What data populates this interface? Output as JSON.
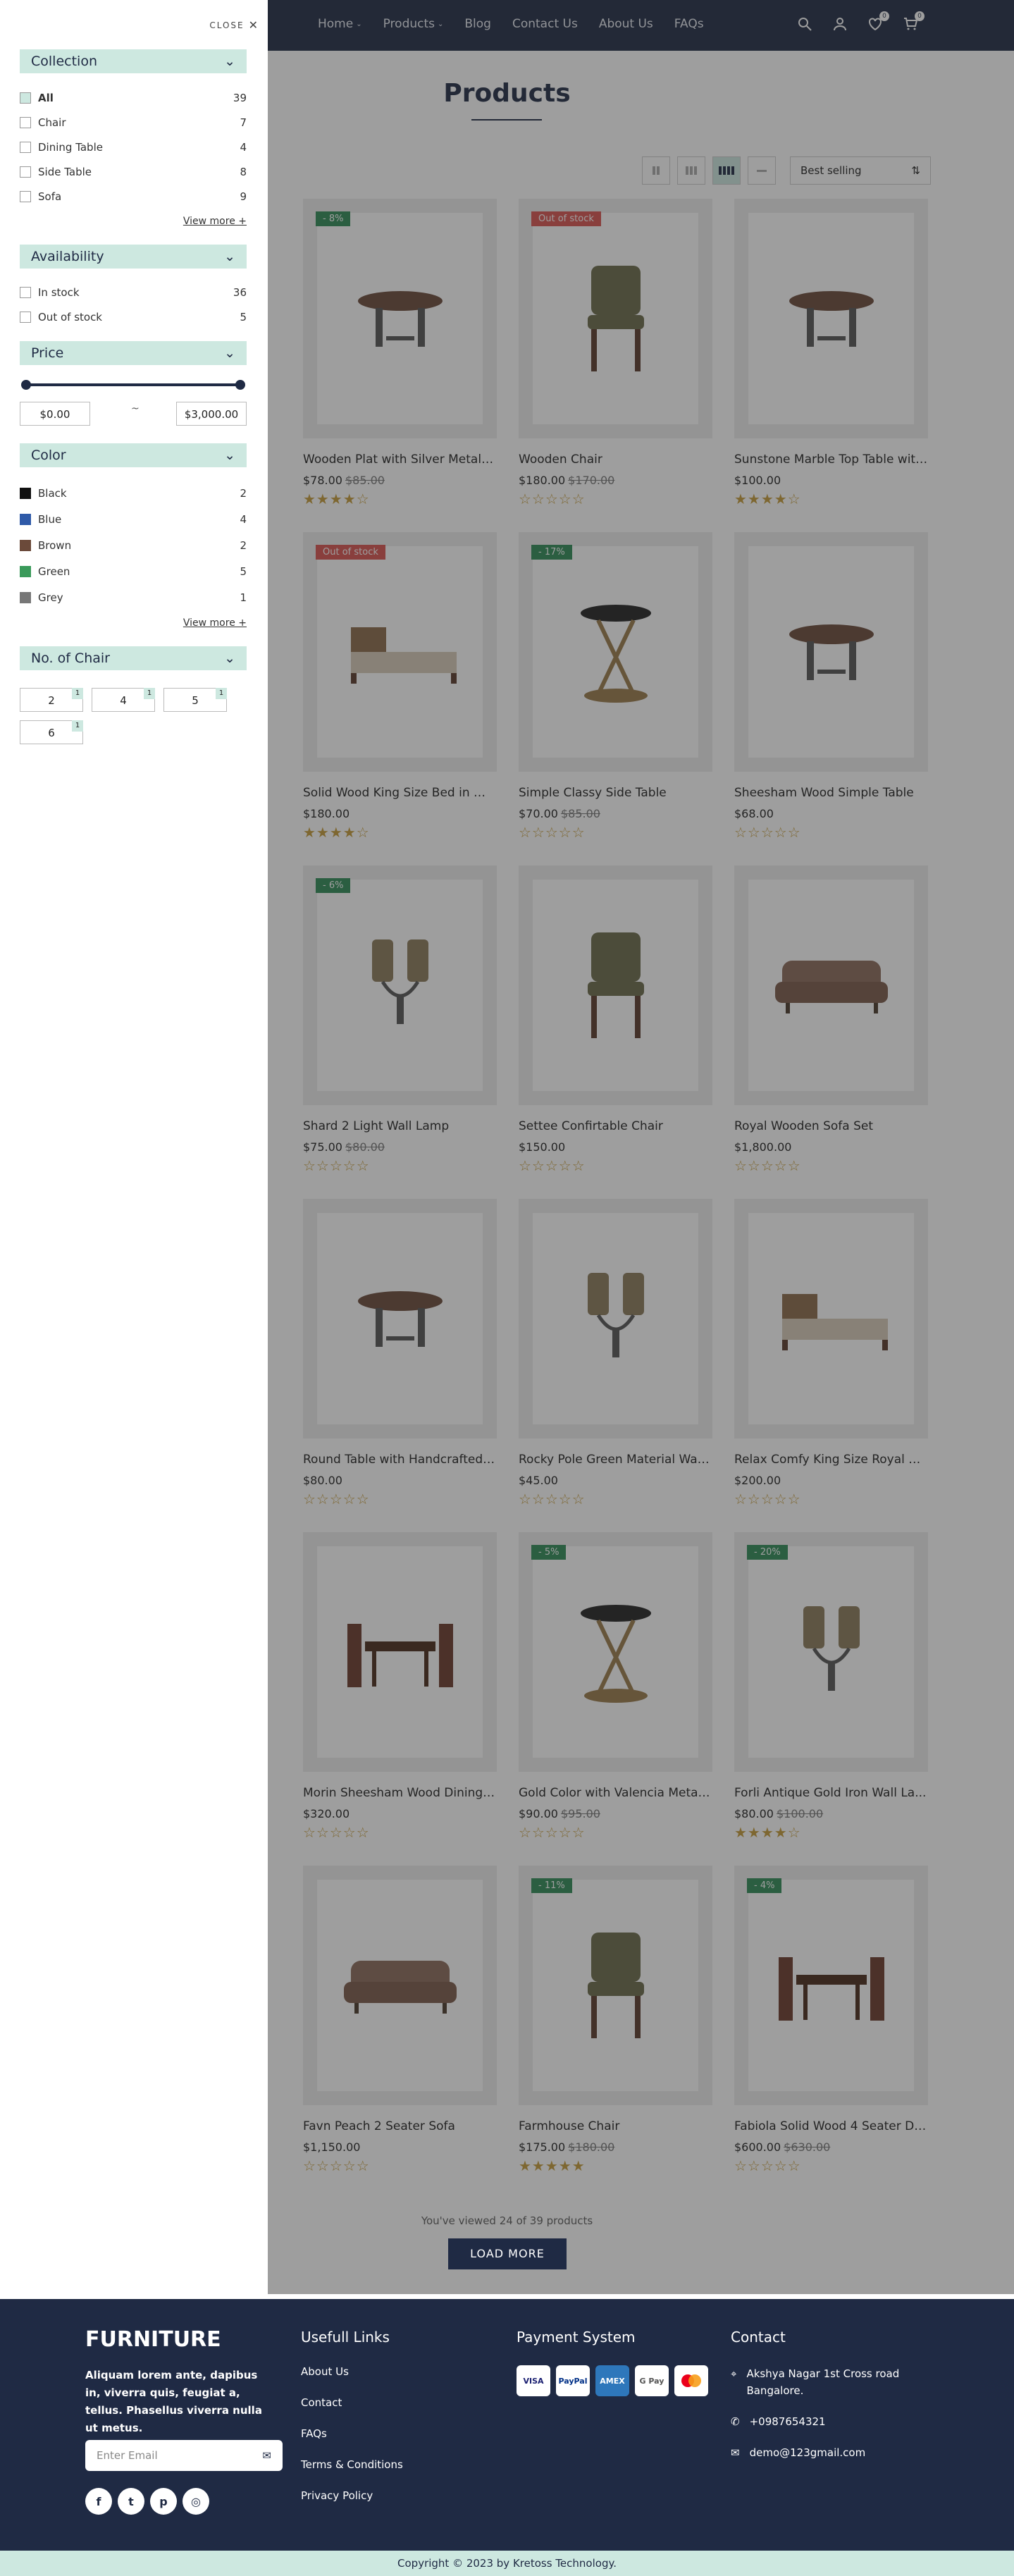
{
  "header": {
    "nav": [
      "Home",
      "Products",
      "Blog",
      "Contact Us",
      "About Us",
      "FAQs"
    ],
    "wishlist_count": "0",
    "cart_count": "0"
  },
  "main": {
    "title": "Products",
    "sort_label": "Best selling",
    "viewed_text": "You've viewed 24 of 39 products",
    "load_more": "LOAD MORE"
  },
  "products": [
    {
      "title": "Wooden Plat with Silver Metal E...",
      "price": "$78.00",
      "old": "$85.00",
      "badge": "- 8%",
      "badge_type": "sale",
      "rating": 4,
      "icon": "table-icon"
    },
    {
      "title": "Wooden Chair",
      "price": "$180.00",
      "old": "$170.00",
      "badge": "Out of stock",
      "badge_type": "out",
      "rating": 0,
      "icon": "chair-icon"
    },
    {
      "title": "Sunstone Marble Top Table with...",
      "price": "$100.00",
      "old": "",
      "badge": "",
      "badge_type": "",
      "rating": 4,
      "icon": "table-icon"
    },
    {
      "title": "Solid Wood King Size Bed in Wh...",
      "price": "$180.00",
      "old": "",
      "badge": "Out of stock",
      "badge_type": "out",
      "rating": 4,
      "icon": "bed-icon"
    },
    {
      "title": "Simple Classy Side Table",
      "price": "$70.00",
      "old": "$85.00",
      "badge": "- 17%",
      "badge_type": "sale",
      "rating": 0,
      "icon": "side-table-icon"
    },
    {
      "title": "Sheesham Wood Simple Table",
      "price": "$68.00",
      "old": "",
      "badge": "",
      "badge_type": "",
      "rating": 0,
      "icon": "table-icon"
    },
    {
      "title": "Shard 2 Light Wall Lamp",
      "price": "$75.00",
      "old": "$80.00",
      "badge": "- 6%",
      "badge_type": "sale",
      "rating": 0,
      "icon": "lamp-icon"
    },
    {
      "title": "Settee Confirtable Chair",
      "price": "$150.00",
      "old": "",
      "badge": "",
      "badge_type": "",
      "rating": 0,
      "icon": "chair-icon"
    },
    {
      "title": "Royal Wooden Sofa Set",
      "price": "$1,800.00",
      "old": "",
      "badge": "",
      "badge_type": "",
      "rating": 0,
      "icon": "sofa-icon"
    },
    {
      "title": "Round Table with Handcrafted ...",
      "price": "$80.00",
      "old": "",
      "badge": "",
      "badge_type": "",
      "rating": 0,
      "icon": "table-icon"
    },
    {
      "title": "Rocky Pole Green Material Wall ...",
      "price": "$45.00",
      "old": "",
      "badge": "",
      "badge_type": "",
      "rating": 0,
      "icon": "lamp-icon"
    },
    {
      "title": "Relax Comfy King Size Royal Bed",
      "price": "$200.00",
      "old": "",
      "badge": "",
      "badge_type": "",
      "rating": 0,
      "icon": "bed-icon"
    },
    {
      "title": "Morin Sheesham Wood Dining S...",
      "price": "$320.00",
      "old": "",
      "badge": "",
      "badge_type": "",
      "rating": 0,
      "icon": "dining-set-icon"
    },
    {
      "title": "Gold Color with Valencia Metal ...",
      "price": "$90.00",
      "old": "$95.00",
      "badge": "- 5%",
      "badge_type": "sale",
      "rating": 0,
      "icon": "side-table-icon"
    },
    {
      "title": "Forli Antique Gold Iron Wall La...",
      "price": "$80.00",
      "old": "$100.00",
      "badge": "- 20%",
      "badge_type": "sale",
      "rating": 4,
      "icon": "lamp-icon"
    },
    {
      "title": "Favn Peach 2 Seater Sofa",
      "price": "$1,150.00",
      "old": "",
      "badge": "",
      "badge_type": "",
      "rating": 0,
      "icon": "sofa-icon"
    },
    {
      "title": "Farmhouse Chair",
      "price": "$175.00",
      "old": "$180.00",
      "badge": "- 11%",
      "badge_type": "sale",
      "rating": 4.5,
      "icon": "chair-icon"
    },
    {
      "title": "Fabiola Solid Wood 4 Seater Di...",
      "price": "$600.00",
      "old": "$630.00",
      "badge": "- 4%",
      "badge_type": "sale",
      "rating": 0,
      "icon": "dining-set-icon"
    }
  ],
  "drawer": {
    "close": "CLOSE",
    "collection_title": "Collection",
    "collection": [
      {
        "label": "All",
        "count": "39",
        "checked": true
      },
      {
        "label": "Chair",
        "count": "7"
      },
      {
        "label": "Dining Table",
        "count": "4"
      },
      {
        "label": "Side Table",
        "count": "8"
      },
      {
        "label": "Sofa",
        "count": "9"
      }
    ],
    "view_more": "View more +",
    "availability_title": "Availability",
    "availability": [
      {
        "label": "In stock",
        "count": "36"
      },
      {
        "label": "Out of stock",
        "count": "5"
      }
    ],
    "price_title": "Price",
    "price_min": "$0.00",
    "price_max": "$3,000.00",
    "price_sep": "~",
    "color_title": "Color",
    "colors": [
      {
        "label": "Black",
        "count": "2",
        "color": "#111111"
      },
      {
        "label": "Blue",
        "count": "4",
        "color": "#2f5aa8"
      },
      {
        "label": "Brown",
        "count": "2",
        "color": "#6b4a3a"
      },
      {
        "label": "Green",
        "count": "5",
        "color": "#3a9a5a"
      },
      {
        "label": "Grey",
        "count": "1",
        "color": "#777777"
      }
    ],
    "chair_title": "No. of Chair",
    "chairs": [
      {
        "label": "2",
        "count": "1"
      },
      {
        "label": "4",
        "count": "1"
      },
      {
        "label": "5",
        "count": "1"
      },
      {
        "label": "6",
        "count": "1"
      }
    ]
  },
  "footer": {
    "logo": "FURNITURE",
    "desc": "Aliquam lorem ante, dapibus in, viverra quis, feugiat a, tellus. Phasellus viverra nulla ut metus.",
    "email_placeholder": "Enter Email",
    "links_title": "Usefull Links",
    "links": [
      "About Us",
      "Contact",
      "FAQs",
      "Terms & Conditions",
      "Privacy Policy"
    ],
    "payment_title": "Payment System",
    "payments": [
      "VISA",
      "PayPal",
      "AMEX",
      "G Pay",
      "MC"
    ],
    "contact_title": "Contact",
    "address": "Akshya Nagar 1st Cross road Bangalore.",
    "phone": "+0987654321",
    "email": "demo@123gmail.com",
    "copyright": "Copyright © 2023 by Kretoss Technology."
  },
  "colors": {
    "navy": "#1f2a44",
    "mint": "#cde8e0",
    "sale": "#2e8b57",
    "out": "#d9534f",
    "star": "#c59c3a"
  }
}
